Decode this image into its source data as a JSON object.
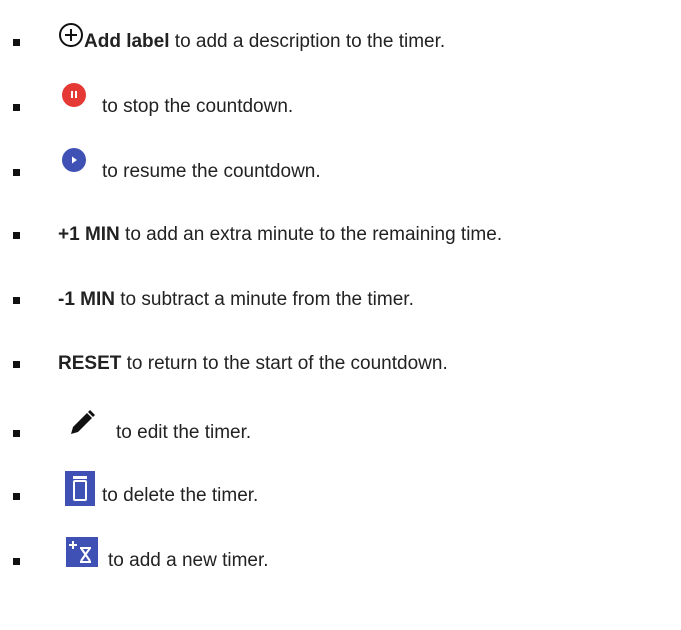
{
  "items": [
    {
      "icon": "add-circle-icon",
      "bold": "Add label",
      "text": " to add a description to the timer."
    },
    {
      "icon": "pause-button-icon",
      "bold": "",
      "text": "to stop the countdown."
    },
    {
      "icon": "play-button-icon",
      "bold": "",
      "text": "to resume the countdown."
    },
    {
      "icon": "",
      "bold": "+1 MIN",
      "text": " to add an extra minute to the remaining time."
    },
    {
      "icon": "",
      "bold": "-1 MIN",
      "text": " to subtract a minute from the timer."
    },
    {
      "icon": "",
      "bold": "RESET",
      "text": " to return to the start of the countdown."
    },
    {
      "icon": "pencil-icon",
      "bold": "",
      "text": "to edit the timer."
    },
    {
      "icon": "trash-icon",
      "bold": "",
      "text": "to delete the timer."
    },
    {
      "icon": "add-timer-icon",
      "bold": "",
      "text": "to add a new timer."
    }
  ],
  "colors": {
    "pause_red": "#e53935",
    "play_blue": "#3f51b5",
    "trash_blue": "#3f51b5",
    "add_timer_blue": "#3f51b5",
    "text": "#222222"
  }
}
